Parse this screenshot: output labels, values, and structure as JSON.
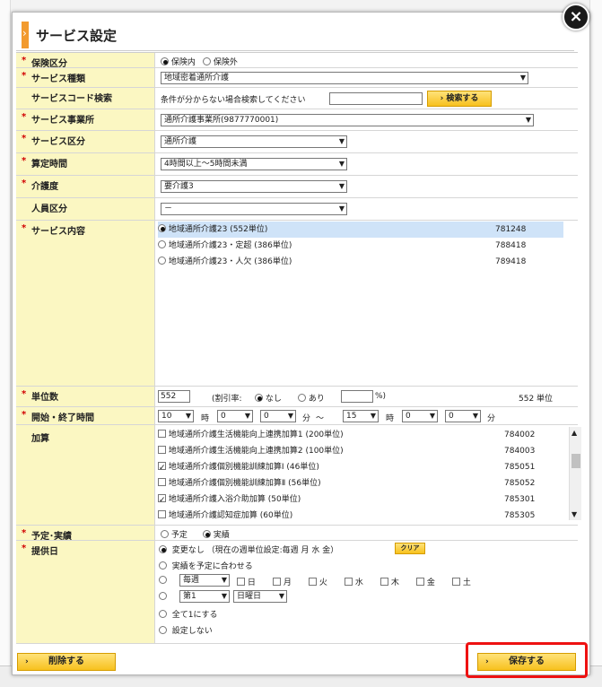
{
  "dialog": {
    "title": "サービス設定",
    "close_glyph": "×"
  },
  "insurance": {
    "label": "保険区分",
    "options": [
      "保険内",
      "保険外"
    ],
    "selected": "保険内"
  },
  "service_type": {
    "label": "サービス種類",
    "value": "地域密着通所介護"
  },
  "code_search": {
    "label": "サービスコード検索",
    "prompt": "条件が分からない場合検索してください",
    "input_value": "",
    "button": "検索する"
  },
  "provider": {
    "label": "サービス事業所",
    "value": "通所介護事業所(9877770001)"
  },
  "service_class": {
    "label": "サービス区分",
    "value": "通所介護"
  },
  "calc_time": {
    "label": "算定時間",
    "value": "4時間以上～5時間未満"
  },
  "care_level": {
    "label": "介護度",
    "value": "要介護3"
  },
  "staff_class": {
    "label": "人員区分",
    "value": "－"
  },
  "service_content": {
    "label": "サービス内容",
    "items": [
      {
        "name": "地域通所介護23 (552単位)",
        "code": "781248",
        "selected": true
      },
      {
        "name": "地域通所介護23・定超 (386単位)",
        "code": "788418",
        "selected": false
      },
      {
        "name": "地域通所介護23・人欠 (386単位)",
        "code": "789418",
        "selected": false
      }
    ]
  },
  "units": {
    "label": "単位数",
    "value": "552",
    "discount_label": "(割引率:",
    "opt_none": "なし",
    "opt_yes": "あり",
    "pct_suffix": "%)",
    "total": "552 単位"
  },
  "time": {
    "label": "開始・終了時間",
    "start_h": "10",
    "start_m1": "0",
    "start_m2": "0",
    "end_h": "15",
    "end_m1": "0",
    "end_m2": "0",
    "hour_unit": "時",
    "minute_unit": "分",
    "tilde": "～"
  },
  "additions": {
    "label": "加算",
    "items": [
      {
        "name": "地域通所介護生活機能向上連携加算1 (200単位)",
        "code": "784002",
        "checked": false
      },
      {
        "name": "地域通所介護生活機能向上連携加算2 (100単位)",
        "code": "784003",
        "checked": false
      },
      {
        "name": "地域通所介護個別機能訓練加算Ⅰ (46単位)",
        "code": "785051",
        "checked": true
      },
      {
        "name": "地域通所介護個別機能訓練加算Ⅱ (56単位)",
        "code": "785052",
        "checked": false
      },
      {
        "name": "地域通所介護入浴介助加算 (50単位)",
        "code": "785301",
        "checked": true
      },
      {
        "name": "地域通所介護認知症加算 (60単位)",
        "code": "785305",
        "checked": false
      }
    ]
  },
  "plan_actual": {
    "label": "予定･実績",
    "options": [
      "予定",
      "実績"
    ],
    "selected": "実績"
  },
  "provide_date": {
    "label": "提供日",
    "opt1": "変更なし （現在の週単位設定:毎週 月 水 金）",
    "clear": "クリア",
    "opt2": "実績を予定に合わせる",
    "freq": "毎週",
    "days": [
      "日",
      "月",
      "火",
      "水",
      "木",
      "金",
      "土"
    ],
    "week_no": "第1",
    "weekday": "日曜日",
    "opt5": "全て1にする",
    "opt6": "設定しない"
  },
  "footer": {
    "delete": "削除する",
    "save": "保存する"
  },
  "colors": {
    "label_bg": "#fbf7c2",
    "required": "#d10000",
    "button_yellow": "#f7c11e",
    "highlight": "#e11111",
    "selected_row": "#cfe3f8"
  }
}
